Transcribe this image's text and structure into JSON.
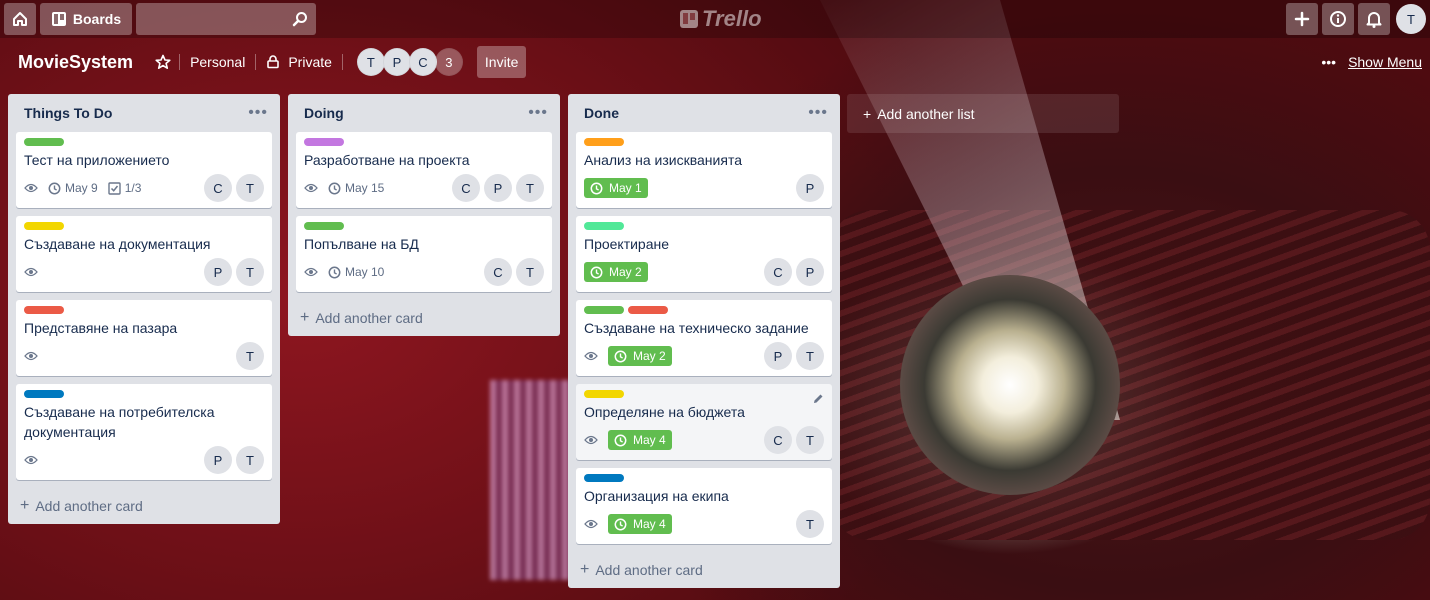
{
  "topbar": {
    "boards_label": "Boards",
    "logo_text": "Trello",
    "user_initial": "T"
  },
  "board": {
    "title": "MovieSystem",
    "team": "Personal",
    "visibility": "Private",
    "members": [
      "T",
      "P",
      "C"
    ],
    "member_count": "3",
    "invite_label": "Invite",
    "show_menu_label": "Show Menu",
    "add_list_label": "Add another list"
  },
  "colors": {
    "green": "#61bd4f",
    "yellow": "#f2d600",
    "orange": "#ff9f1a",
    "red": "#eb5a46",
    "purple": "#c377e0",
    "blue": "#0079bf",
    "lime": "#51e898"
  },
  "lists": [
    {
      "title": "Things To Do",
      "add_card_label": "Add another card",
      "cards": [
        {
          "labels": [
            "#61bd4f"
          ],
          "title": "Тест на приложението",
          "watch": true,
          "due": "May 9",
          "due_done": false,
          "checklist": "1/3",
          "members": [
            "C",
            "T"
          ]
        },
        {
          "labels": [
            "#f2d600"
          ],
          "title": "Създаване на документация",
          "watch": true,
          "due": "",
          "due_done": false,
          "checklist": "",
          "members": [
            "P",
            "T"
          ]
        },
        {
          "labels": [
            "#eb5a46"
          ],
          "title": "Представяне на пазара",
          "watch": true,
          "due": "",
          "due_done": false,
          "checklist": "",
          "members": [
            "T"
          ]
        },
        {
          "labels": [
            "#0079bf"
          ],
          "title": "Създаване на потребителска документация",
          "watch": true,
          "due": "",
          "due_done": false,
          "checklist": "",
          "members": [
            "P",
            "T"
          ]
        }
      ]
    },
    {
      "title": "Doing",
      "add_card_label": "Add another card",
      "cards": [
        {
          "labels": [
            "#c377e0"
          ],
          "title": "Разработване на проекта",
          "watch": true,
          "due": "May 15",
          "due_done": false,
          "checklist": "",
          "members": [
            "C",
            "P",
            "T"
          ]
        },
        {
          "labels": [
            "#61bd4f"
          ],
          "title": "Попълване на БД",
          "watch": true,
          "due": "May 10",
          "due_done": false,
          "checklist": "",
          "members": [
            "C",
            "T"
          ]
        }
      ]
    },
    {
      "title": "Done",
      "add_card_label": "Add another card",
      "cards": [
        {
          "labels": [
            "#ff9f1a"
          ],
          "title": "Анализ на изискванията",
          "watch": false,
          "due": "May 1",
          "due_done": true,
          "checklist": "",
          "members": [
            "P"
          ]
        },
        {
          "labels": [
            "#51e898"
          ],
          "title": "Проектиране",
          "watch": false,
          "due": "May 2",
          "due_done": true,
          "checklist": "",
          "members": [
            "C",
            "P"
          ]
        },
        {
          "labels": [
            "#61bd4f",
            "#eb5a46"
          ],
          "title": "Създаване на техническо задание",
          "watch": true,
          "due": "May 2",
          "due_done": true,
          "checklist": "",
          "members": [
            "P",
            "T"
          ]
        },
        {
          "labels": [
            "#f2d600"
          ],
          "title": "Определяне на бюджета",
          "watch": true,
          "due": "May 4",
          "due_done": true,
          "checklist": "",
          "members": [
            "C",
            "T"
          ],
          "hover_edit": true
        },
        {
          "labels": [
            "#0079bf"
          ],
          "title": "Организация на екипа",
          "watch": true,
          "due": "May 4",
          "due_done": true,
          "checklist": "",
          "members": [
            "T"
          ]
        }
      ]
    }
  ]
}
